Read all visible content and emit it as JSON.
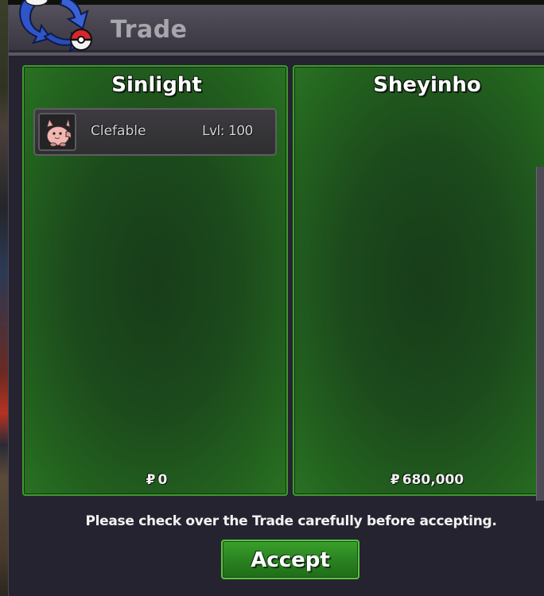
{
  "window": {
    "title": "Trade"
  },
  "left_panel": {
    "player_name": "Sinlight",
    "items": [
      {
        "icon": "clefable-sprite-icon",
        "name": "Clefable",
        "level": "Lvl: 100"
      }
    ],
    "money_symbol": "₽",
    "money": "0"
  },
  "right_panel": {
    "player_name": "Sheyinho",
    "items": [],
    "money_symbol": "₽",
    "money": "680,000"
  },
  "footer": {
    "hint": "Please check over the Trade carefully before accepting.",
    "accept_label": "Accept"
  },
  "colors": {
    "panel_green": "#1c4a1c",
    "panel_border": "#3f9a2d",
    "accept_button": "#2a8420",
    "title_bar": "#45424d"
  }
}
